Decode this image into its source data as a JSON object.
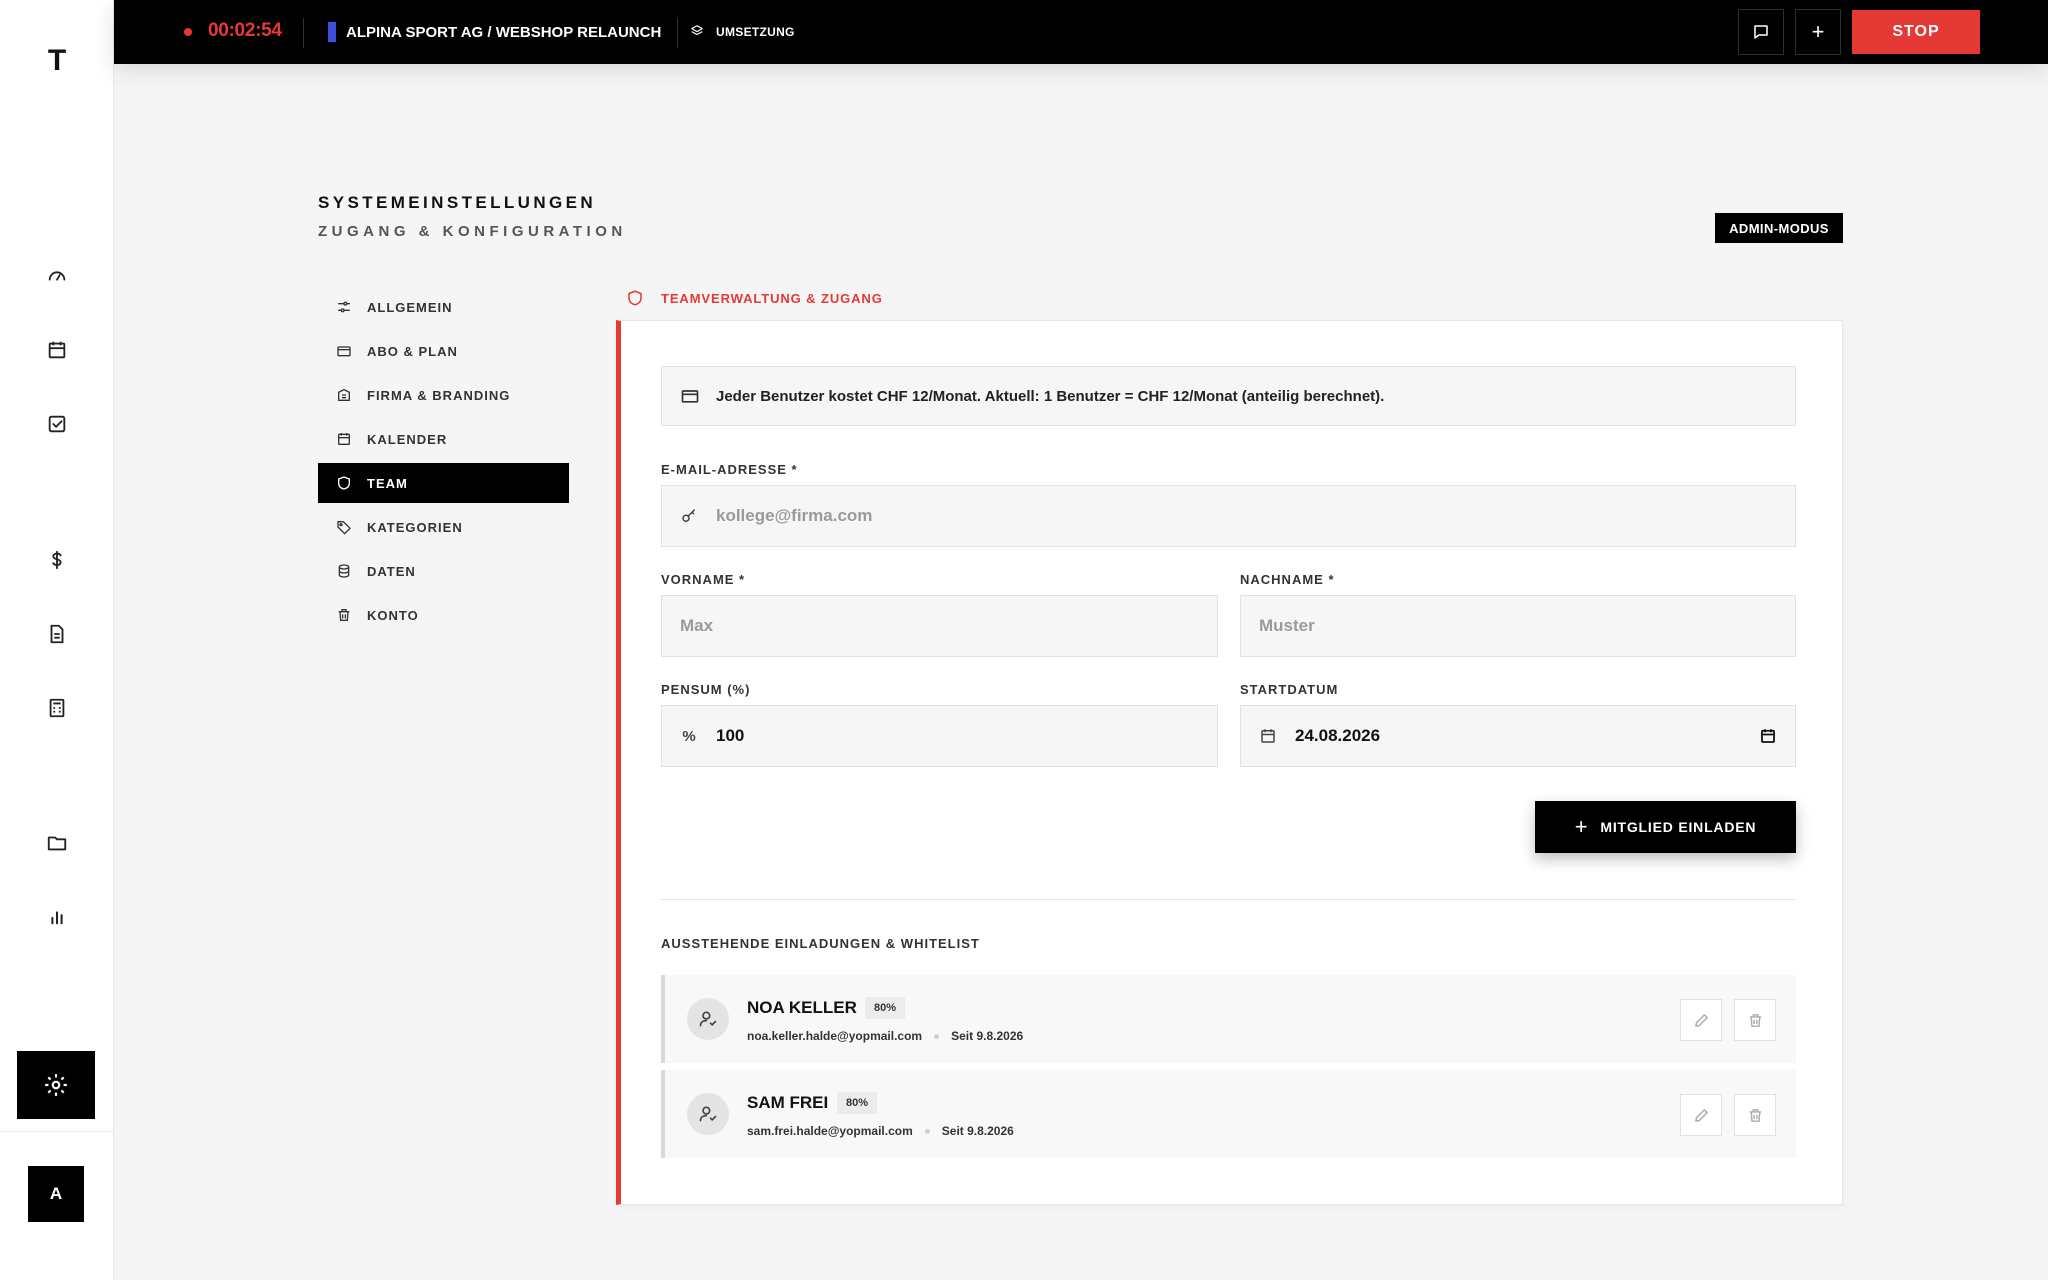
{
  "app": {
    "logo": "T"
  },
  "topbar": {
    "timer": "00:02:54",
    "project": "ALPINA SPORT AG / WEBSHOP RELAUNCH",
    "phase": "UMSETZUNG",
    "add_label": "+",
    "stop_label": "STOP",
    "colors": {
      "accent": "#e53935",
      "project": "#3b4fd8"
    }
  },
  "rail": {
    "items": [
      "dashboard-icon",
      "calendar-icon",
      "tasks-icon",
      "dollar-icon",
      "document-icon",
      "calculator-icon",
      "folder-icon",
      "chart-icon",
      "gear-icon"
    ],
    "avatar": "A"
  },
  "header": {
    "title": "SYSTEMEINSTELLUNGEN",
    "subtitle": "ZUGANG & KONFIGURATION",
    "badge": "ADMIN-MODUS"
  },
  "settings_nav": {
    "items": [
      {
        "label": "ALLGEMEIN",
        "icon": "sliders-icon"
      },
      {
        "label": "ABO & PLAN",
        "icon": "credit-card-icon"
      },
      {
        "label": "FIRMA & BRANDING",
        "icon": "building-icon"
      },
      {
        "label": "KALENDER",
        "icon": "calendar-icon"
      },
      {
        "label": "TEAM",
        "icon": "shield-icon",
        "active": true
      },
      {
        "label": "KATEGORIEN",
        "icon": "tag-icon"
      },
      {
        "label": "DATEN",
        "icon": "database-icon"
      },
      {
        "label": "KONTO",
        "icon": "trash-icon"
      }
    ]
  },
  "section": {
    "label": "TEAMVERWALTUNG & ZUGANG"
  },
  "notice": {
    "text": "Jeder Benutzer kostet CHF 12/Monat. Aktuell: 1 Benutzer = CHF 12/Monat (anteilig berechnet)."
  },
  "form": {
    "email": {
      "label": "E-MAIL-ADRESSE *",
      "placeholder": "kollege@firma.com",
      "value": ""
    },
    "firstname": {
      "label": "VORNAME *",
      "placeholder": "Max",
      "value": ""
    },
    "lastname": {
      "label": "NACHNAME *",
      "placeholder": "Muster",
      "value": ""
    },
    "pensum": {
      "label": "PENSUM (%)",
      "value": "100",
      "prefix": "%"
    },
    "startdate": {
      "label": "STARTDATUM",
      "value": "24.08.2026"
    },
    "invite_label": "MITGLIED EINLADEN"
  },
  "pending": {
    "title": "AUSSTEHENDE EINLADUNGEN & WHITELIST",
    "members": [
      {
        "name": "NOA KELLER",
        "pensum": "80%",
        "email": "noa.keller.halde@yopmail.com",
        "since": "Seit 9.8.2026"
      },
      {
        "name": "SAM FREI",
        "pensum": "80%",
        "email": "sam.frei.halde@yopmail.com",
        "since": "Seit 9.8.2026"
      }
    ]
  }
}
